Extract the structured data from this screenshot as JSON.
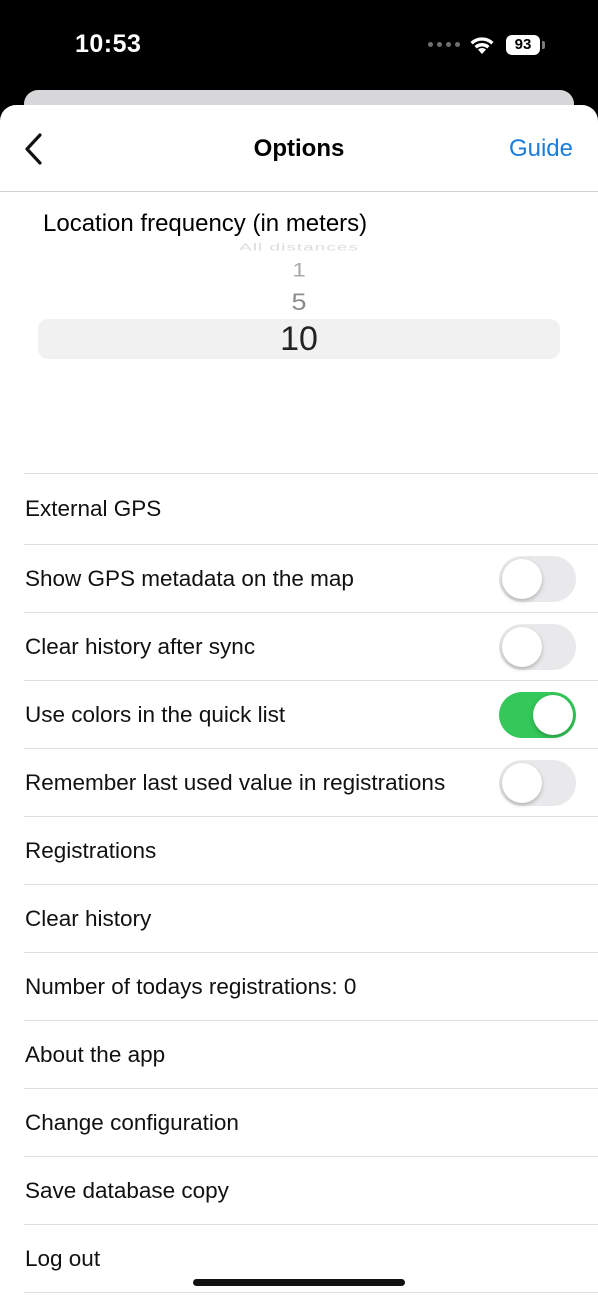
{
  "status_bar": {
    "time": "10:53",
    "battery": "93"
  },
  "nav": {
    "title": "Options",
    "guide": "Guide"
  },
  "picker": {
    "label": "Location frequency (in meters)",
    "options": [
      "All distances",
      "1",
      "5",
      "10"
    ],
    "selected": "10"
  },
  "settings": [
    {
      "label": "External GPS"
    },
    {
      "label": "Show GPS metadata on the map",
      "toggle": false
    },
    {
      "label": "Clear history after sync",
      "toggle": false
    },
    {
      "label": "Use colors in the quick list",
      "toggle": true
    },
    {
      "label": "Remember last used value in registrations",
      "toggle": false
    },
    {
      "label": "Registrations"
    },
    {
      "label": "Clear history"
    },
    {
      "label": "Number of todays registrations: 0"
    },
    {
      "label": "About the app"
    },
    {
      "label": "Change configuration"
    },
    {
      "label": "Save database copy"
    },
    {
      "label": "Log out"
    }
  ],
  "colors": {
    "accent": "#1a7ddb",
    "toggle_on": "#34c759",
    "toggle_off": "#e9e9eb"
  }
}
